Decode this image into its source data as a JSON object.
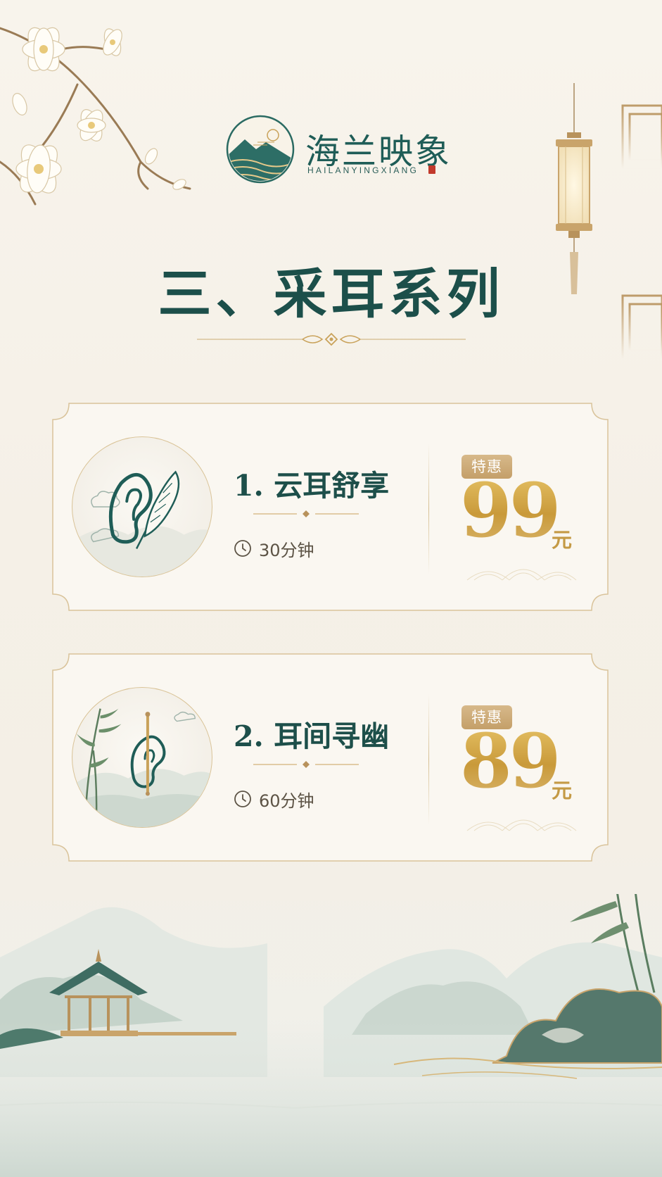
{
  "brand": {
    "name": "海兰映象",
    "pinyin": "HAILANYINGXIANG"
  },
  "section": {
    "title": "三、采耳系列"
  },
  "services": [
    {
      "name": "1. 云耳舒享",
      "duration": "30分钟",
      "badge": "特惠",
      "price": "99",
      "unit": "元",
      "icon": "ear-feather-icon"
    },
    {
      "name": "2. 耳间寻幽",
      "duration": "60分钟",
      "badge": "特惠",
      "price": "89",
      "unit": "元",
      "icon": "ear-pick-icon"
    }
  ],
  "colors": {
    "primary_green": "#1d4f4a",
    "gold": "#c89f45",
    "background": "#f6f1e8"
  }
}
